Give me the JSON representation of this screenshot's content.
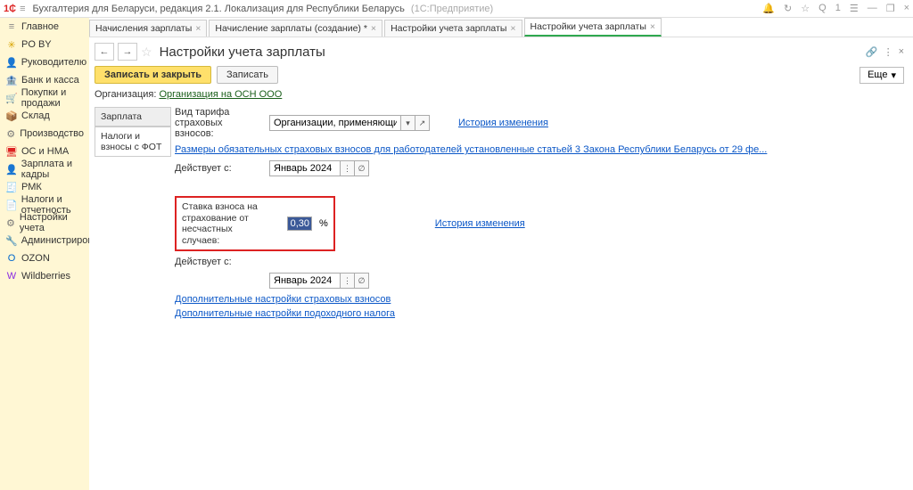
{
  "titlebar": {
    "app": "Бухгалтерия для Беларуси, редакция 2.1. Локализация для Республики Беларусь",
    "engine": "(1С:Предприятие)"
  },
  "titlebar_icons": {
    "bell": "🔔",
    "history": "↻",
    "star": "☆",
    "search": "Q",
    "one": "1",
    "user": "☰",
    "minimize": "—",
    "restore": "❐",
    "close": "×"
  },
  "sidebar": {
    "burger": "≡",
    "items": [
      {
        "icon": "≡",
        "color": "#888",
        "label": "Главное"
      },
      {
        "icon": "✳",
        "color": "#d8a400",
        "label": "PO BY"
      },
      {
        "icon": "👤",
        "color": "#777",
        "label": "Руководителю"
      },
      {
        "icon": "🏦",
        "color": "#2aa",
        "label": "Банк и касса"
      },
      {
        "icon": "🛒",
        "color": "#4a4",
        "label": "Покупки и продажи"
      },
      {
        "icon": "📦",
        "color": "#8a5",
        "label": "Склад"
      },
      {
        "icon": "⚙",
        "color": "#777",
        "label": "Производство"
      },
      {
        "icon": "🖥",
        "color": "#d22",
        "label": "ОС и НМА"
      },
      {
        "icon": "👤",
        "color": "#777",
        "label": "Зарплата и кадры"
      },
      {
        "icon": "🧾",
        "color": "#e57",
        "label": "РМК"
      },
      {
        "icon": "📄",
        "color": "#777",
        "label": "Налоги и отчетность"
      },
      {
        "icon": "⚙",
        "color": "#777",
        "label": "Настройки учета"
      },
      {
        "icon": "🔧",
        "color": "#777",
        "label": "Администрирование"
      },
      {
        "icon": "O",
        "color": "#06c",
        "label": "OZON"
      },
      {
        "icon": "W",
        "color": "#8a2be2",
        "label": "Wildberries"
      }
    ]
  },
  "tabs": [
    {
      "label": "Начисления зарплаты",
      "active": false
    },
    {
      "label": "Начисление зарплаты (создание) *",
      "active": false
    },
    {
      "label": "Настройки учета зарплаты",
      "active": false
    },
    {
      "label": "Настройки учета зарплаты",
      "active": true
    }
  ],
  "page": {
    "title": "Настройки учета зарплаты",
    "nav_back": "←",
    "nav_fwd": "→",
    "star": "☆",
    "save_close": "Записать и закрыть",
    "save": "Записать",
    "more": "Еще",
    "org_label": "Организация:",
    "org_link": "Организация на ОСН ООО",
    "side_tabs": [
      {
        "label": "Зарплата",
        "active": true
      },
      {
        "label": "Налоги и взносы с ФОТ",
        "active": false
      }
    ],
    "tariff_label": "Вид тарифа страховых взносов:",
    "tariff_value": "Организации, применяющие ОСН, кр",
    "info_link": "Размеры обязательных страховых взносов для работодателей установленные статьей 3 Закона Республики Беларусь от 29 фе...",
    "history_link": "История изменения",
    "effective_label": "Действует с:",
    "date1": "Январь 2024",
    "rate_label": "Ставка взноса на страхование от несчастных случаев:",
    "rate_value": "0,30",
    "rate_suffix": "%",
    "date2": "Январь 2024",
    "link_extra1": "Дополнительные настройки страховых взносов",
    "link_extra2": "Дополнительные настройки подоходного налога",
    "header_icons": {
      "link": "🔗",
      "menu": "⋮",
      "close": "×"
    }
  }
}
